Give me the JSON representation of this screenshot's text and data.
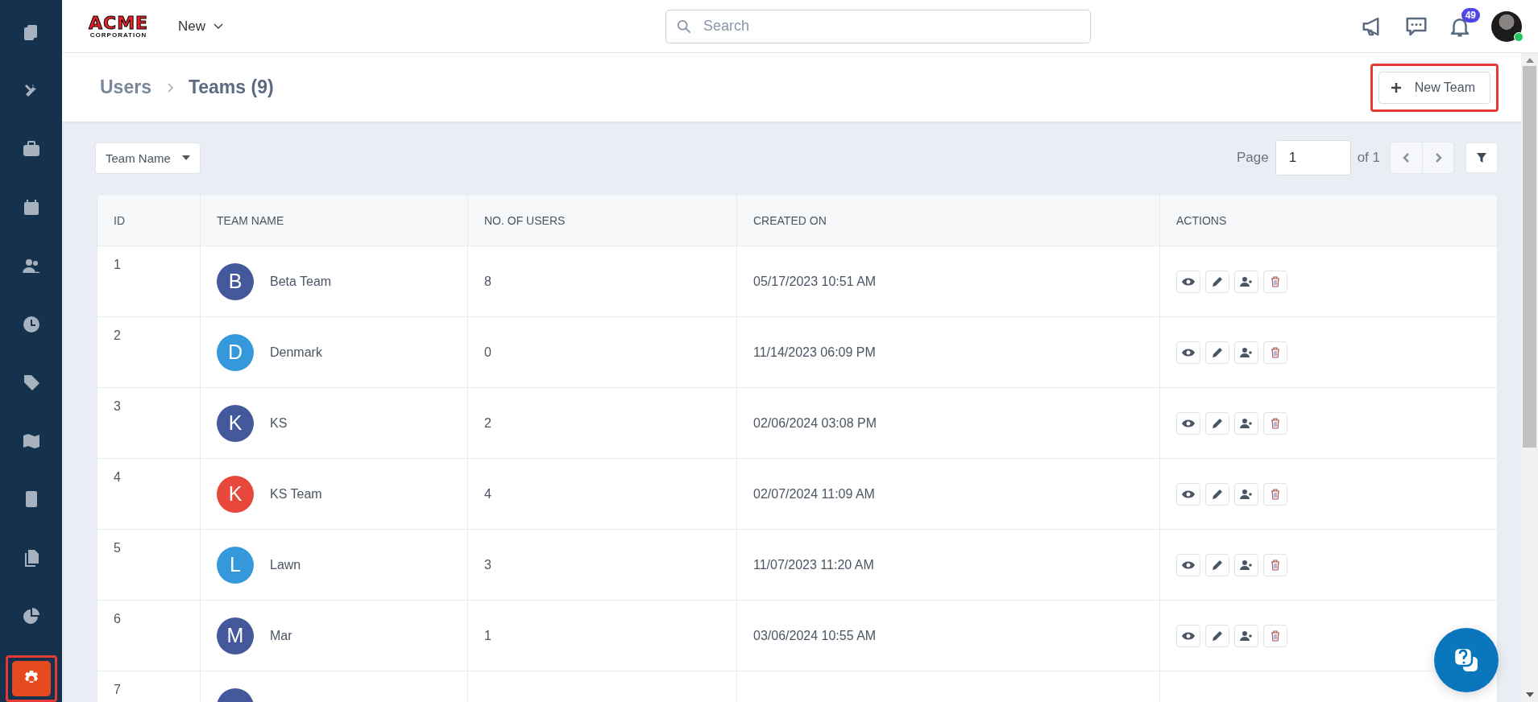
{
  "sidebar": {
    "items": [
      {
        "selected": false
      },
      {
        "selected": false
      },
      {
        "selected": false
      },
      {
        "selected": false
      },
      {
        "selected": false
      },
      {
        "selected": false
      },
      {
        "selected": false
      },
      {
        "selected": false
      },
      {
        "selected": false
      },
      {
        "selected": false
      },
      {
        "selected": false
      },
      {
        "selected": true
      }
    ]
  },
  "topbar": {
    "logo": {
      "main": "ACME",
      "sub": "CORPORATION"
    },
    "new_menu": "New",
    "search": {
      "placeholder": "Search"
    },
    "notifications": "49"
  },
  "breadcrumb": [
    "Users",
    "Teams (9)"
  ],
  "new_team_button": "New Team",
  "filter": {
    "label": "Team Name"
  },
  "pagination": {
    "label": "Page",
    "value": "1",
    "of": "of 1"
  },
  "table": {
    "columns": [
      "ID",
      "TEAM NAME",
      "NO. OF USERS",
      "CREATED ON",
      "ACTIONS"
    ],
    "rows": [
      {
        "id": "1",
        "initial": "B",
        "color": "#44599b",
        "name": "Beta Team",
        "users": "8",
        "created": "05/17/2023 10:51 AM"
      },
      {
        "id": "2",
        "initial": "D",
        "color": "#3498db",
        "name": "Denmark",
        "users": "0",
        "created": "11/14/2023 06:09 PM"
      },
      {
        "id": "3",
        "initial": "K",
        "color": "#44599b",
        "name": "KS",
        "users": "2",
        "created": "02/06/2024 03:08 PM"
      },
      {
        "id": "4",
        "initial": "K",
        "color": "#e8473c",
        "name": "KS Team",
        "users": "4",
        "created": "02/07/2024 11:09 AM"
      },
      {
        "id": "5",
        "initial": "L",
        "color": "#3498db",
        "name": "Lawn",
        "users": "3",
        "created": "11/07/2023 11:20 AM"
      },
      {
        "id": "6",
        "initial": "M",
        "color": "#44599b",
        "name": "Mar",
        "users": "1",
        "created": "03/06/2024 10:55 AM"
      },
      {
        "id": "7",
        "color": "#44599b"
      }
    ]
  }
}
